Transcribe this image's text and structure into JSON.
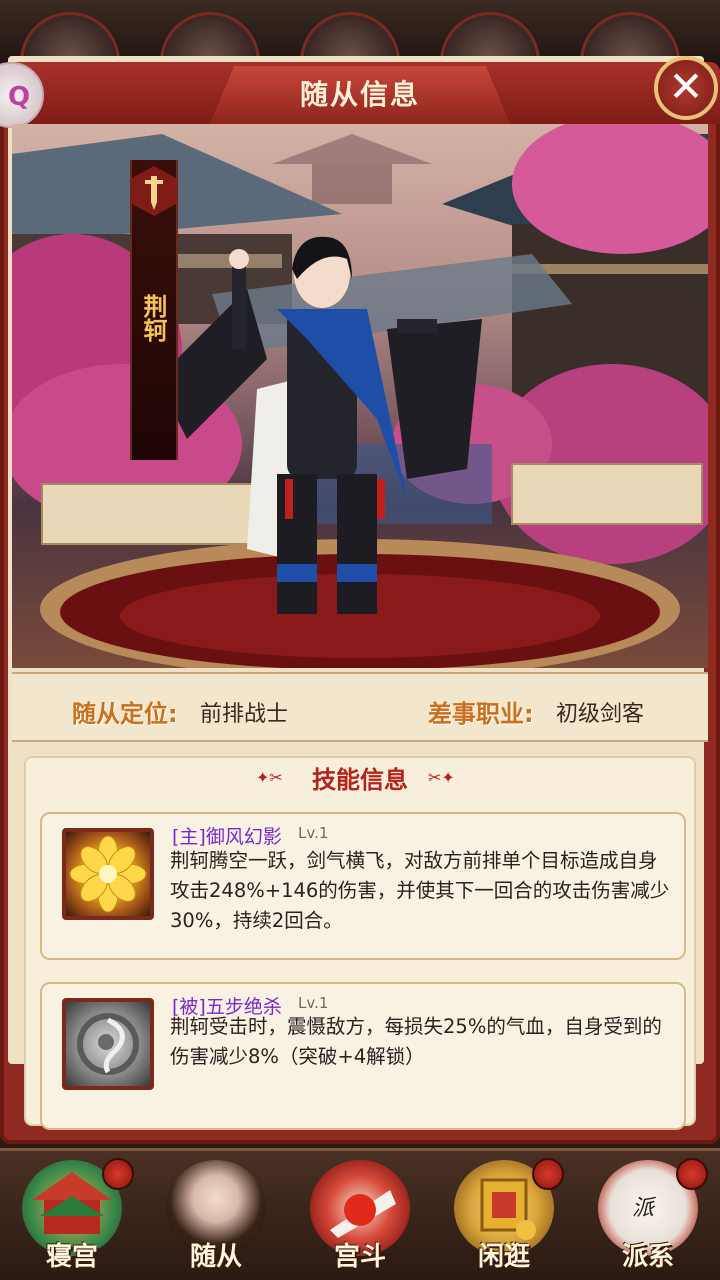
{
  "header": {
    "title": "随从信息",
    "close_icon": "close-icon"
  },
  "side_badge": {
    "glyph": "Q"
  },
  "companion": {
    "name": "荆轲",
    "class_icon": "dagger-icon"
  },
  "info": {
    "role_label": "随从定位:",
    "role_value": "前排战士",
    "job_label": "差事职业:",
    "job_value": "初级剑客"
  },
  "skills": {
    "title": "技能信息",
    "items": [
      {
        "name": "[主]御风幻影",
        "level": "Lv.1",
        "description": "荆轲腾空一跃，剑气横飞，对敌方前排单个目标造成自身攻击248%+146的伤害，并使其下一回合的攻击伤害减少30%，持续2回合。",
        "icon": "golden-flower-icon"
      },
      {
        "name": "[被]五步绝杀",
        "level": "Lv.1",
        "description": "荆轲受击时，震慑敌方，每损失25%的气血，自身受到的伤害减少8%（突破+4解锁）",
        "icon": "grey-swirl-icon"
      }
    ]
  },
  "nav": {
    "items": [
      {
        "label": "寝宫",
        "icon": "palace-icon",
        "color": "#3a8a4a"
      },
      {
        "label": "随从",
        "icon": "companion-portrait-icon",
        "color": "#6a4a3a"
      },
      {
        "label": "宫斗",
        "icon": "fan-icon",
        "color": "#c83a2a"
      },
      {
        "label": "闲逛",
        "icon": "sedan-chair-icon",
        "color": "#d8a23a"
      },
      {
        "label": "派系",
        "icon": "faction-icon",
        "color": "#e8e0d8"
      }
    ],
    "nav_dot_char": "派"
  },
  "colors": {
    "panel_red": "#8e2a1f",
    "accent_gold": "#c8701c",
    "skill_name_purple": "#7a2acc"
  }
}
